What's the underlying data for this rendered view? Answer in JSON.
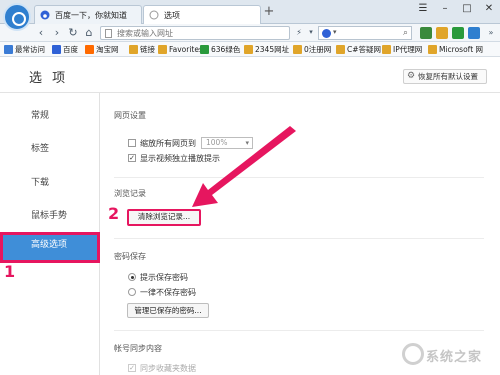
{
  "tabs": [
    {
      "label": "百度一下，你就知道",
      "active": false
    },
    {
      "label": "选项",
      "active": true
    }
  ],
  "window": {
    "menu_icon": "☰",
    "minimize": "–",
    "maximize": "□",
    "close": "✕"
  },
  "nav": {
    "url_placeholder": "搜索或输入网址",
    "search_engine_caret": "▾",
    "search_icon": "search-icon"
  },
  "bookmarks": [
    {
      "label": "最常访问",
      "color": "#3a7bd5"
    },
    {
      "label": "百度",
      "color": "#2f61d6"
    },
    {
      "label": "淘宝网",
      "color": "#ff6a00"
    },
    {
      "label": "链接",
      "color": "#e0a52a"
    },
    {
      "label": "Favorites",
      "color": "#e0a52a"
    },
    {
      "label": "636绿色",
      "color": "#2a9a3c"
    },
    {
      "label": "2345网址",
      "color": "#e0a52a"
    },
    {
      "label": "0注册网",
      "color": "#e0a52a"
    },
    {
      "label": "C#答疑网",
      "color": "#e0a52a"
    },
    {
      "label": "IP代理网",
      "color": "#e0a52a"
    },
    {
      "label": "Microsoft 网",
      "color": "#e0a52a"
    }
  ],
  "options": {
    "title": "选 项",
    "restore_button": "恢复所有默认设置"
  },
  "sidebar": {
    "items": [
      {
        "label": "常规",
        "active": false
      },
      {
        "label": "标签",
        "active": false
      },
      {
        "label": "下载",
        "active": false
      },
      {
        "label": "鼠标手势",
        "active": false
      },
      {
        "label": "高级选项",
        "active": true
      }
    ]
  },
  "content": {
    "web_settings": {
      "title": "网页设置",
      "zoom_all_label": "缩放所有网页到",
      "zoom_all_checked": false,
      "zoom_value": "100%",
      "show_video_label": "显示视频独立播放提示",
      "show_video_checked": true
    },
    "history": {
      "title": "浏览记录",
      "clear_button": "清除浏览记录..."
    },
    "password": {
      "title": "密码保存",
      "option_prompt": "提示保存密码",
      "option_never": "一律不保存密码",
      "selected": "prompt",
      "manage_button": "管理已保存的密码..."
    },
    "sync": {
      "title": "帐号同步内容",
      "option_favorites": "同步收藏夹数据"
    }
  },
  "annotations": {
    "step1": "1",
    "step2": "2",
    "color": "#e6165f"
  },
  "watermark": {
    "text": "系统之家"
  }
}
